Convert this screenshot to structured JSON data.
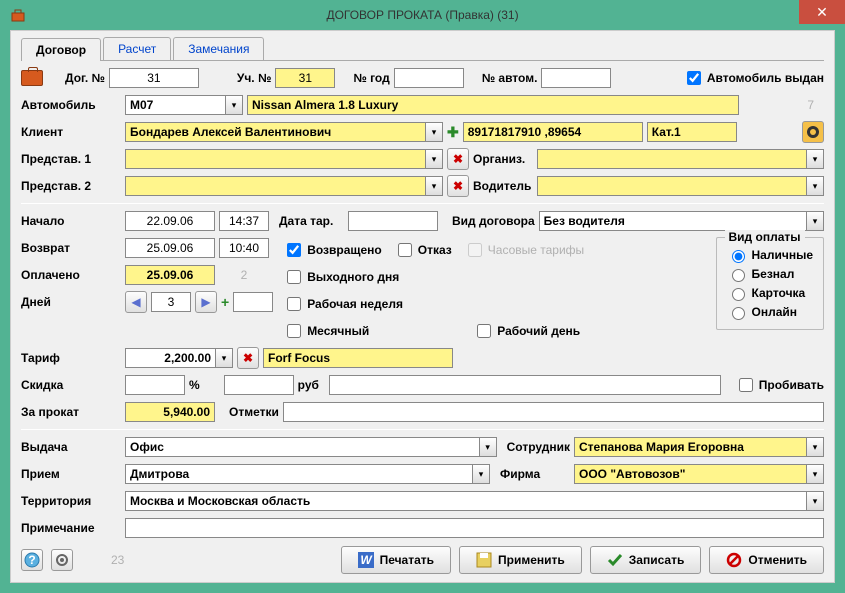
{
  "window": {
    "title": "ДОГОВОР ПРОКАТА (Правка)  (31)"
  },
  "tabs": {
    "t1": "Договор",
    "t2": "Расчет",
    "t3": "Замечания"
  },
  "labels": {
    "dog_no": "Дог. №",
    "uch_no": "Уч. №",
    "no_year": "№ год",
    "no_auto": "№ автом.",
    "auto_issued": "Автомобиль выдан",
    "automobile": "Автомобиль",
    "client": "Клиент",
    "rep1": "Представ. 1",
    "rep2": "Представ. 2",
    "organ": "Организ.",
    "driver": "Водитель",
    "start": "Начало",
    "return": "Возврат",
    "paid": "Оплачено",
    "days": "Дней",
    "date_tar": "Дата тар.",
    "contract_type": "Вид договора",
    "returned": "Возвращено",
    "refusal": "Отказ",
    "hourly": "Часовые тарифы",
    "weekend": "Выходного дня",
    "work_week": "Рабочая неделя",
    "monthly": "Месячный",
    "work_day": "Рабочий день",
    "payment_type": "Вид оплаты",
    "cash": "Наличные",
    "noncash": "Безнал",
    "card": "Карточка",
    "online": "Онлайн",
    "tariff": "Тариф",
    "discount": "Скидка",
    "pct": "%",
    "rub": "руб",
    "punch": "Пробивать",
    "rental": "За прокат",
    "marks": "Отметки",
    "issue": "Выдача",
    "employee": "Сотрудник",
    "receipt": "Прием",
    "firm": "Фирма",
    "territory": "Территория",
    "note": "Примечание",
    "footer_num": "23"
  },
  "values": {
    "dog_no": "31",
    "uch_no": "31",
    "no_year": "",
    "no_auto": "",
    "auto_code": "M07",
    "auto_name": "Nissan Almera 1.8 Luxury",
    "auto_right": "7",
    "client": "Бондарев Алексей Валентинович",
    "client_phone": "89171817910 ,89654",
    "client_cat": "Кат.1",
    "rep1": "",
    "rep2": "",
    "organ": "",
    "driver": "",
    "start_date": "22.09.06",
    "start_time": "14:37",
    "return_date": "25.09.06",
    "return_time": "10:40",
    "paid_date": "25.09.06",
    "paid_right": "2",
    "days": "3",
    "days_extra": "",
    "date_tar": "",
    "contract_type": "Без водителя",
    "tariff": "2,200.00",
    "tariff_name": "Forf Focus",
    "discount_pct": "",
    "discount_rub": "",
    "rental": "5,940.00",
    "marks": "",
    "issue": "Офис",
    "employee": "Степанова Мария Егоровна",
    "receipt": "Дмитрова",
    "firm": "ООО \"Автовозов\"",
    "territory": "Москва и Московская область",
    "note": ""
  },
  "checks": {
    "auto_issued": true,
    "returned": true,
    "refusal": false,
    "hourly": false,
    "weekend": false,
    "work_week": false,
    "monthly": false,
    "work_day": false,
    "punch": false
  },
  "payment": "cash",
  "buttons": {
    "print": "Печатать",
    "apply": "Применить",
    "save": "Записать",
    "cancel": "Отменить"
  }
}
